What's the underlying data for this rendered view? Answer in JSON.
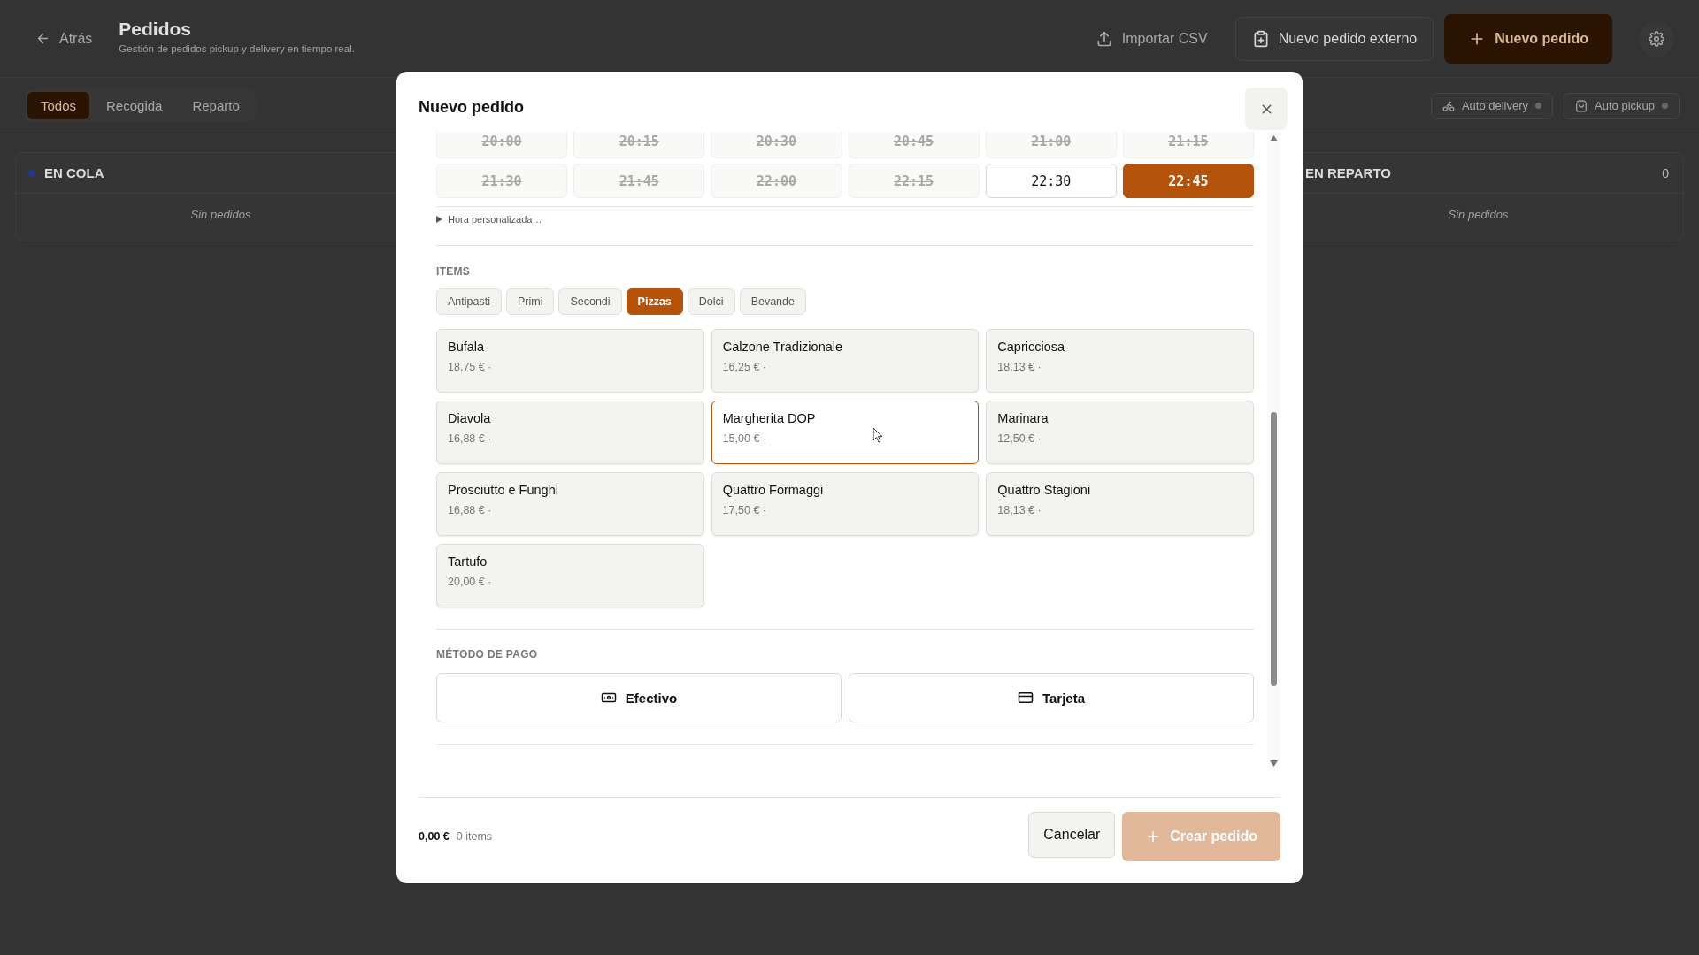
{
  "header": {
    "back": "Atrás",
    "title": "Pedidos",
    "subtitle": "Gestión de pedidos pickup y delivery en tiempo real.",
    "actions": [
      {
        "kind": "import",
        "label": "Importar CSV"
      },
      {
        "kind": "external",
        "label": "Nuevo pedido externo"
      },
      {
        "kind": "primary",
        "label": "Nuevo pedido"
      },
      {
        "kind": "settings"
      }
    ]
  },
  "filters": [
    {
      "label": "Todos",
      "selected": true
    },
    {
      "label": "Recogida",
      "selected": false
    },
    {
      "label": "Reparto",
      "selected": false
    }
  ],
  "toggles": [
    {
      "kind": "delivery",
      "label": "Auto delivery",
      "on": false
    },
    {
      "kind": "pickup",
      "label": "Auto pickup",
      "on": false
    }
  ],
  "columns": [
    {
      "title": "EN COLA",
      "color": "#1e3a8a",
      "empty": "Sin pedidos"
    },
    {
      "title": "EN REPARTO",
      "count": "0",
      "empty": "Sin pedidos"
    }
  ],
  "modal": {
    "title": "Nuevo pedido",
    "time_slots": [
      {
        "time": "20:00",
        "disabled": true,
        "selected": false
      },
      {
        "time": "20:15",
        "disabled": true,
        "selected": false
      },
      {
        "time": "20:30",
        "disabled": true,
        "selected": false
      },
      {
        "time": "20:45",
        "disabled": true,
        "selected": false
      },
      {
        "time": "21:00",
        "disabled": true,
        "selected": false
      },
      {
        "time": "21:15",
        "disabled": true,
        "selected": false
      },
      {
        "time": "21:30",
        "disabled": true,
        "selected": false
      },
      {
        "time": "21:45",
        "disabled": true,
        "selected": false
      },
      {
        "time": "22:00",
        "disabled": true,
        "selected": false
      },
      {
        "time": "22:15",
        "disabled": true,
        "selected": false
      },
      {
        "time": "22:30",
        "disabled": false,
        "selected": false
      },
      {
        "time": "22:45",
        "disabled": false,
        "selected": true
      }
    ],
    "custom_time": "Hora personalizada…",
    "items_label": "ITEMS",
    "categories": [
      {
        "label": "Antipasti",
        "selected": false
      },
      {
        "label": "Primi",
        "selected": false
      },
      {
        "label": "Secondi",
        "selected": false
      },
      {
        "label": "Pizzas",
        "selected": true
      },
      {
        "label": "Dolci",
        "selected": false
      },
      {
        "label": "Bevande",
        "selected": false
      }
    ],
    "products": [
      {
        "name": "Bufala",
        "price": "18,75 € ·",
        "hovered": false
      },
      {
        "name": "Calzone Tradizionale",
        "price": "16,25 € ·",
        "hovered": false
      },
      {
        "name": "Capricciosa",
        "price": "18,13 € ·",
        "hovered": false
      },
      {
        "name": "Diavola",
        "price": "16,88 € ·",
        "hovered": false
      },
      {
        "name": "Margherita DOP",
        "price": "15,00 € ·",
        "hovered": true
      },
      {
        "name": "Marinara",
        "price": "12,50 € ·",
        "hovered": false
      },
      {
        "name": "Prosciutto e Funghi",
        "price": "16,88 € ·",
        "hovered": false
      },
      {
        "name": "Quattro Formaggi",
        "price": "17,50 € ·",
        "hovered": false
      },
      {
        "name": "Quattro Stagioni",
        "price": "18,13 € ·",
        "hovered": false
      },
      {
        "name": "Tartufo",
        "price": "20,00 € ·",
        "hovered": false
      }
    ],
    "payment_label": "MÉTODO DE PAGO",
    "payment_methods": [
      {
        "kind": "cash",
        "label": "Efectivo",
        "selected": false
      },
      {
        "kind": "card",
        "label": "Tarjeta",
        "selected": false
      }
    ],
    "footer": {
      "total": "0,00 €",
      "count": "0 items",
      "cancel": "Cancelar",
      "submit": {
        "label": "Crear pedido",
        "disabled": true
      }
    }
  }
}
